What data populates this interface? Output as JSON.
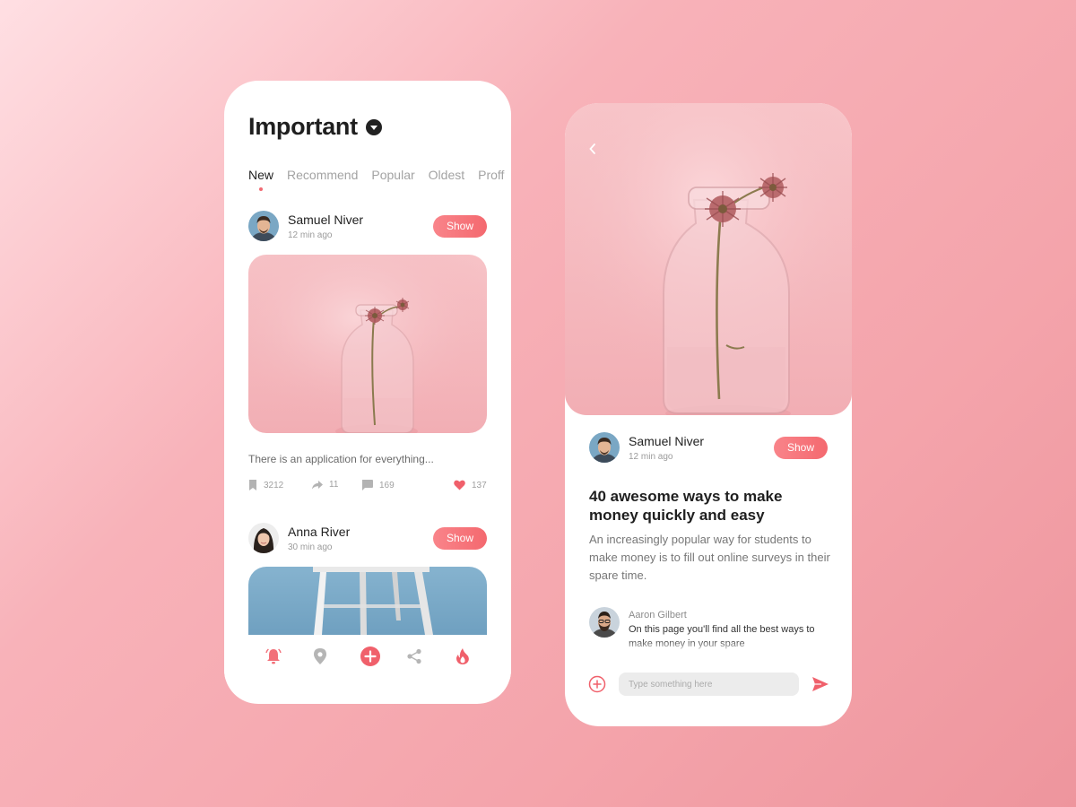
{
  "colors": {
    "accent": "#f4696f",
    "background": "#f6a8af",
    "text": "#1f1f1f",
    "muted": "#a3a3a3"
  },
  "feed": {
    "title": "Important",
    "tabs": [
      "New",
      "Recommend",
      "Popular",
      "Oldest",
      "Proff"
    ],
    "active_tab": "New",
    "posts": [
      {
        "author": "Samuel Niver",
        "time": "12 min ago",
        "button": "Show",
        "image": "pink-flower-vase-photo",
        "caption": "There is an application for everything...",
        "stats": {
          "bookmarks": "3212",
          "shares": "11",
          "comments": "169",
          "likes": "137"
        }
      },
      {
        "author": "Anna River",
        "time": "30 min ago",
        "button": "Show",
        "image": "white-stool-blue-photo"
      }
    ],
    "nav_icons": [
      "bell-icon",
      "location-pin-icon",
      "plus-circle-icon",
      "share-icon",
      "flame-icon"
    ]
  },
  "article": {
    "author": "Samuel Niver",
    "time": "12 min ago",
    "button": "Show",
    "title": "40 awesome ways to make money quickly and easy",
    "description": "An increasingly popular way for students to make money is to fill out online surveys in their spare time.",
    "comment": {
      "author": "Aaron Gilbert",
      "text": "On this page you'll find all the best ways to make money in your spare"
    },
    "composer": {
      "placeholder": "Type something here"
    }
  }
}
